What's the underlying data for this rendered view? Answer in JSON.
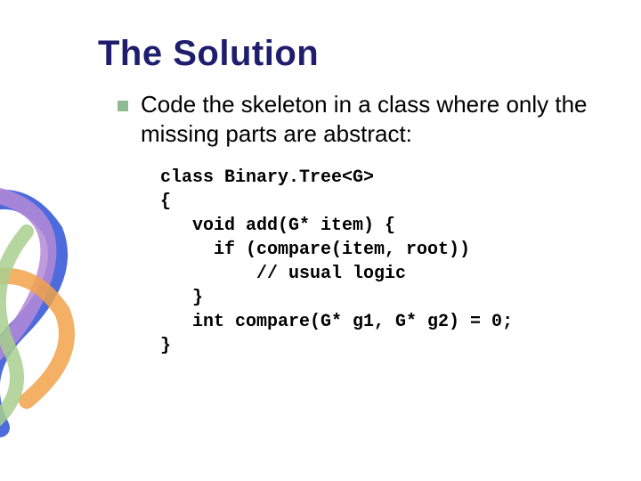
{
  "title": "The Solution",
  "bullet": "Code the skeleton in a class where only the missing parts are abstract:",
  "code": "class Binary.Tree<G>\n{\n   void add(G* item) {\n     if (compare(item, root))\n         // usual logic\n   }\n   int compare(G* g1, G* g2) = 0;\n}",
  "decor_colors": {
    "blue": "#3a5bd9",
    "purple": "#b48ad6",
    "orange": "#f2a24a",
    "green": "#a8cf8e"
  }
}
